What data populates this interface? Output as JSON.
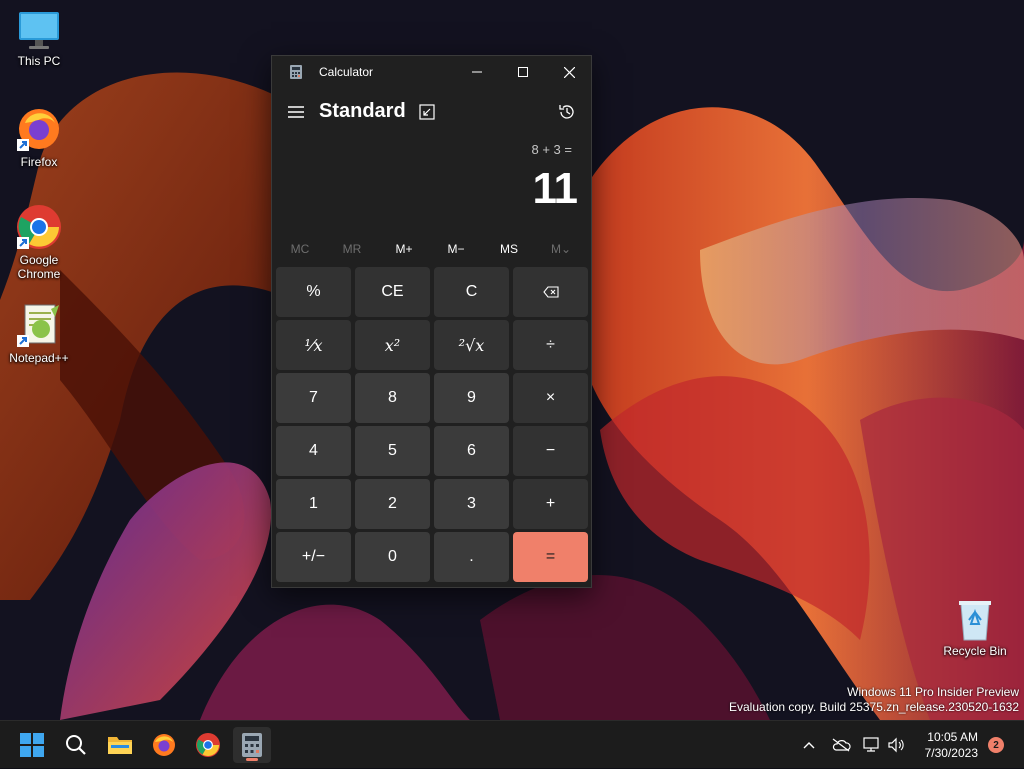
{
  "desktop": {
    "icons": [
      "This PC",
      "Firefox",
      "Google Chrome",
      "Notepad++",
      "Recycle Bin"
    ],
    "watermark": {
      "line1": "Windows 11 Pro Insider Preview",
      "line2": "Evaluation copy. Build 25375.zn_release.230520-1632"
    }
  },
  "calculator": {
    "window_title": "Calculator",
    "mode": "Standard",
    "expression": "8 + 3 =",
    "display": "11",
    "memory": [
      "MC",
      "MR",
      "M+",
      "M−",
      "MS",
      "M⌄"
    ],
    "keys": [
      "%",
      "CE",
      "C",
      "⌫",
      "¹⁄x",
      "x²",
      "²√x",
      "÷",
      "7",
      "8",
      "9",
      "×",
      "4",
      "5",
      "6",
      "−",
      "1",
      "2",
      "3",
      "+",
      "+/−",
      "0",
      ".",
      "="
    ],
    "accent_color": "#f0806a"
  },
  "taskbar": {
    "apps": [
      "start-icon",
      "search-icon",
      "file-explorer-icon",
      "firefox-icon",
      "chrome-icon",
      "calculator-icon"
    ],
    "time": "10:05 AM",
    "date": "7/30/2023",
    "notification_count": "2"
  }
}
